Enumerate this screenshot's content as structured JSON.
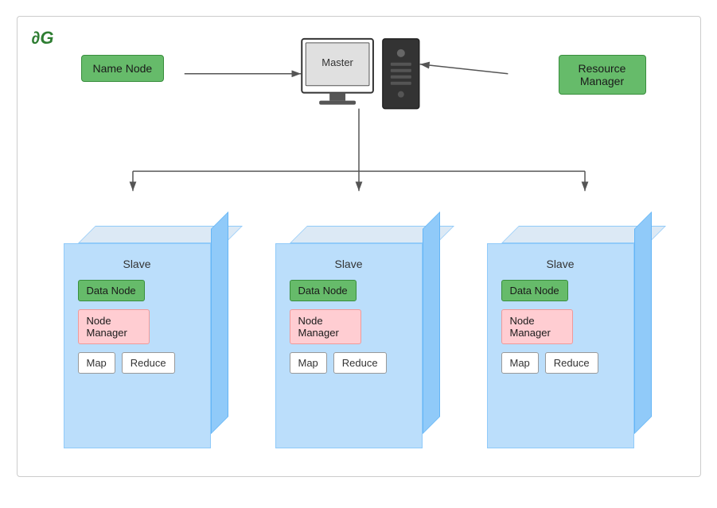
{
  "logo": "∂G",
  "master": {
    "label": "Master"
  },
  "nameNode": {
    "label": "Name Node"
  },
  "resourceManager": {
    "label": "Resource\nManager"
  },
  "slaves": [
    {
      "id": "slave-1",
      "label": "Slave",
      "dataNode": "Data Node",
      "nodeManager": "Node\nManager",
      "map": "Map",
      "reduce": "Reduce"
    },
    {
      "id": "slave-2",
      "label": "Slave",
      "dataNode": "Data Node",
      "nodeManager": "Node\nManager",
      "map": "Map",
      "reduce": "Reduce"
    },
    {
      "id": "slave-3",
      "label": "Slave",
      "dataNode": "Data Node",
      "nodeManager": "Node\nManager",
      "map": "Map",
      "reduce": "Reduce"
    }
  ],
  "colors": {
    "green": "#66bb6a",
    "greenBorder": "#388e3c",
    "pink": "#ffcdd2",
    "pinkBorder": "#ef9a9a",
    "blue": "#bbdefb",
    "blueDark": "#90caf9",
    "accent": "#2e7d32"
  }
}
